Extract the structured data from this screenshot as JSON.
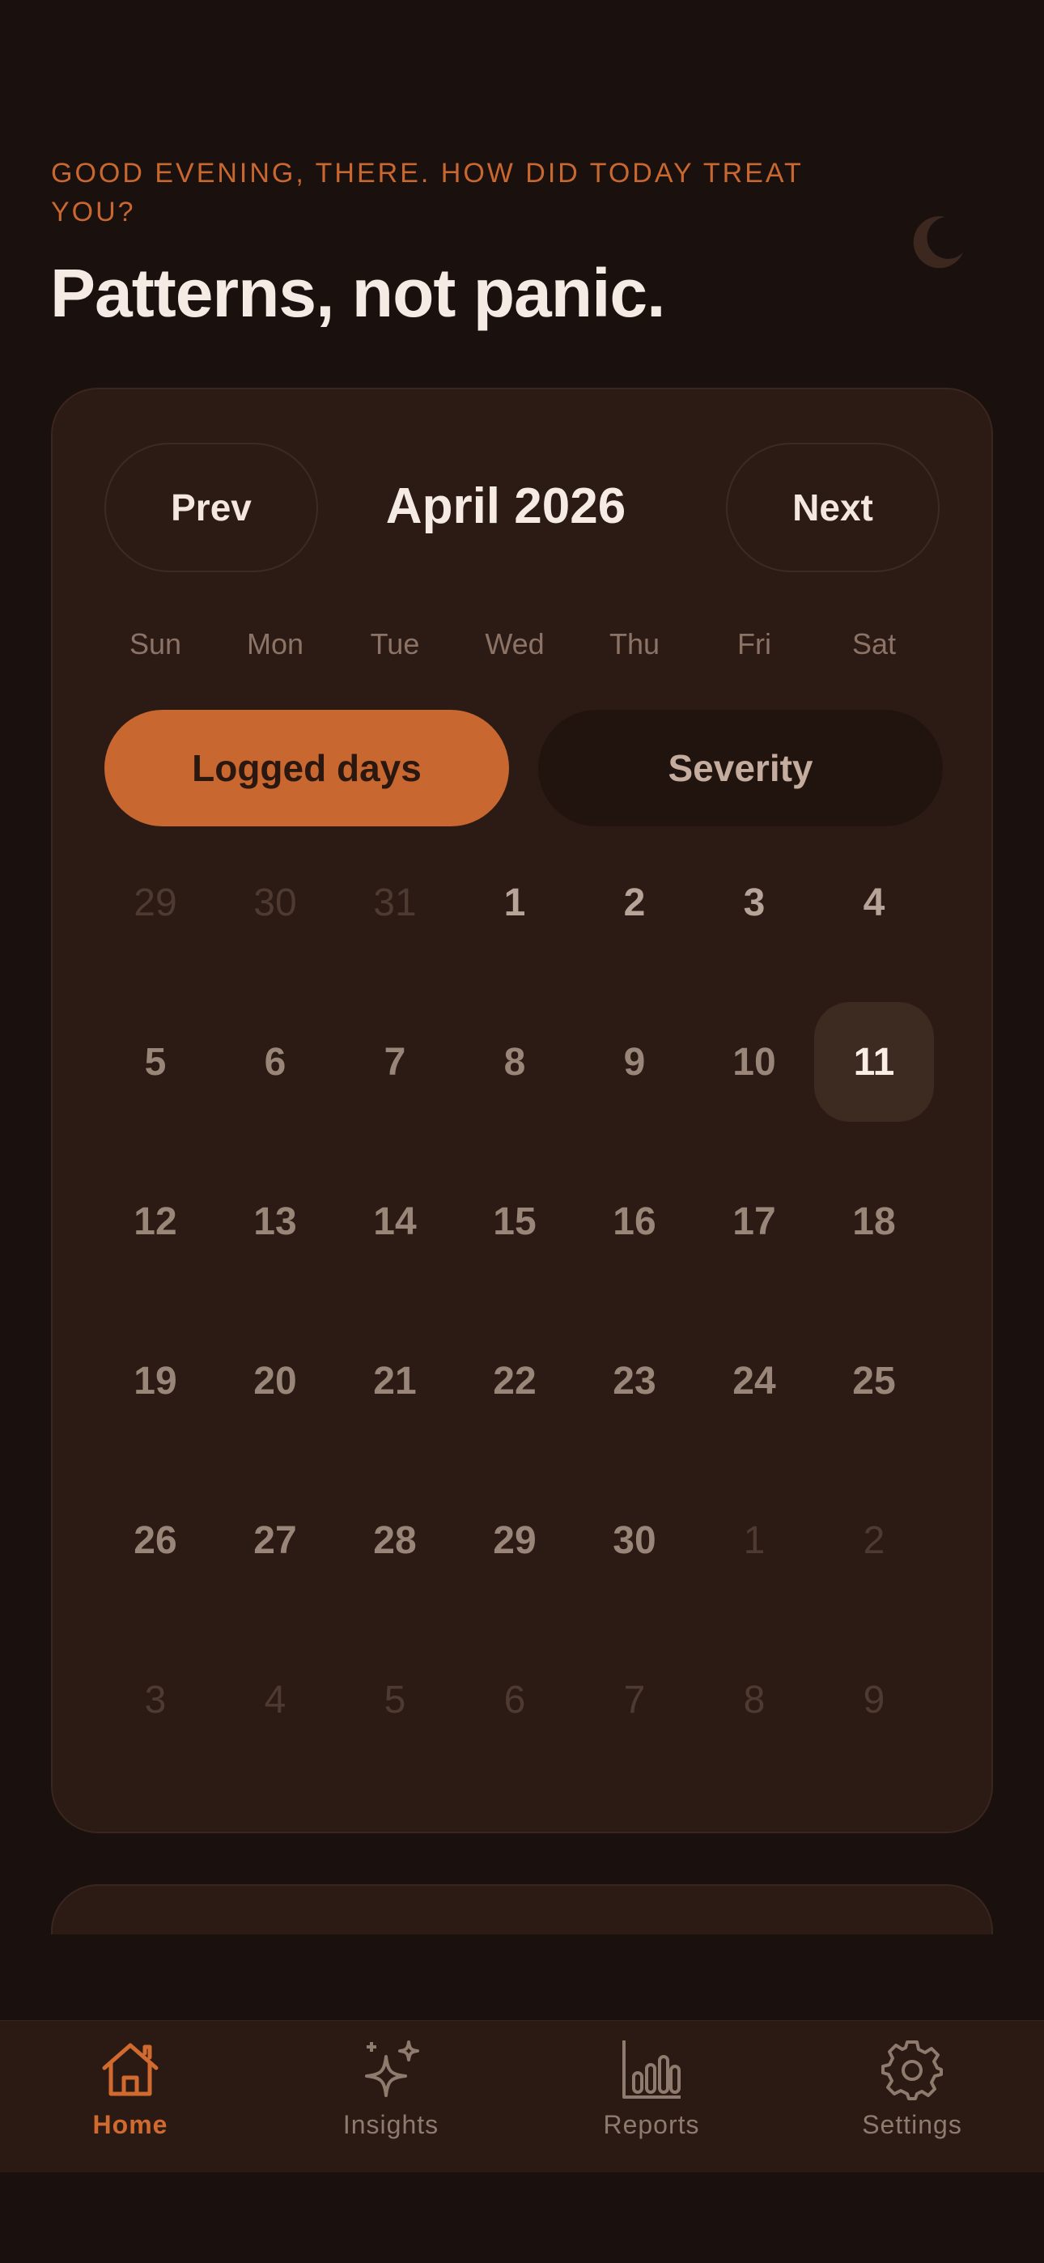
{
  "header": {
    "greeting": "GOOD EVENING, THERE. HOW DID TODAY TREAT YOU?",
    "headline": "Patterns, not panic.",
    "theme_icon": "moon-icon"
  },
  "calendar": {
    "prev_label": "Prev",
    "next_label": "Next",
    "month_title": "April 2026",
    "weekdays": [
      "Sun",
      "Mon",
      "Tue",
      "Wed",
      "Thu",
      "Fri",
      "Sat"
    ],
    "mode_toggle": {
      "logged_label": "Logged days",
      "severity_label": "Severity",
      "selected": "Logged days"
    },
    "selected_day": "11",
    "days": [
      "29",
      "30",
      "31",
      "1",
      "2",
      "3",
      "4",
      "5",
      "6",
      "7",
      "8",
      "9",
      "10",
      "11",
      "12",
      "13",
      "14",
      "15",
      "16",
      "17",
      "18",
      "19",
      "20",
      "21",
      "22",
      "23",
      "24",
      "25",
      "26",
      "27",
      "28",
      "29",
      "30",
      "1",
      "2",
      "3",
      "4",
      "5",
      "6",
      "7",
      "8",
      "9"
    ]
  },
  "tabbar": {
    "tabs": [
      {
        "label": "Home",
        "icon": "home-icon",
        "active": true
      },
      {
        "label": "Insights",
        "icon": "sparkles-icon",
        "active": false
      },
      {
        "label": "Reports",
        "icon": "bar-chart-icon",
        "active": false
      },
      {
        "label": "Settings",
        "icon": "gear-icon",
        "active": false
      }
    ]
  },
  "colors": {
    "background": "#1a100d",
    "card": "#2c1b15",
    "accent": "#c8672f",
    "text_primary": "#f6ebe4",
    "text_muted": "#8c7366"
  }
}
